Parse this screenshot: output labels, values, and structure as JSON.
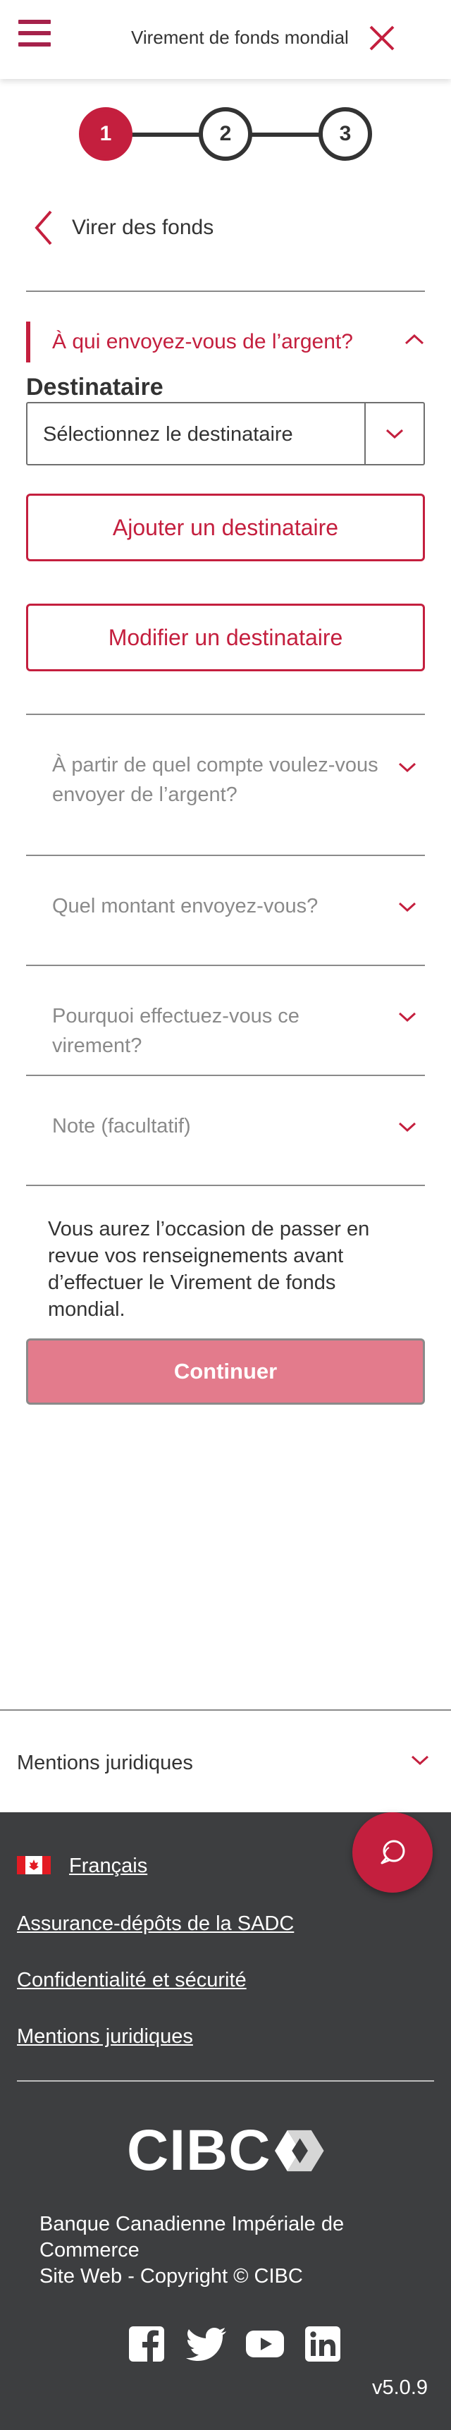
{
  "header": {
    "title": "Virement de fonds mondial"
  },
  "stepper": {
    "steps": [
      "1",
      "2",
      "3"
    ],
    "active_step": 1
  },
  "back": {
    "label": "Virer des fonds"
  },
  "recipient_section": {
    "title": "À qui envoyez-vous de l’argent?",
    "field_label": "Destinataire",
    "select_value": "Sélectionnez le destinataire",
    "add_button": "Ajouter un destinataire",
    "edit_button": "Modifier un destinataire"
  },
  "accordions": [
    {
      "label": "À partir de quel compte voulez-vous envoyer de l’argent?"
    },
    {
      "label": "Quel montant envoyez-vous?"
    },
    {
      "label": "Pourquoi effectuez-vous ce virement?"
    },
    {
      "label": "Note (facultatif)"
    }
  ],
  "info_text": "Vous aurez l’occasion de passer en revue vos renseignements avant d’effectuer le Virement de fonds mondial.",
  "continue_button": "Continuer",
  "legal_bar": {
    "label": "Mentions juridiques"
  },
  "footer": {
    "language_link": "Français",
    "links": [
      "Assurance-dépôts de la SADC",
      "Confidentialité et sécurité",
      "Mentions juridiques"
    ],
    "logo": "CIBC",
    "copyright_line1": "Banque Canadienne Impériale de Commerce",
    "copyright_line2": "Site Web - Copyright © CIBC",
    "social": [
      "facebook-icon",
      "twitter-icon",
      "youtube-icon",
      "linkedin-icon"
    ],
    "version": "v5.0.9"
  },
  "colors": {
    "brand_red": "#c41f3e",
    "menu_red": "#a6224b",
    "continue_disabled": "#e37b8c",
    "footer_bg": "#3d3e40"
  }
}
